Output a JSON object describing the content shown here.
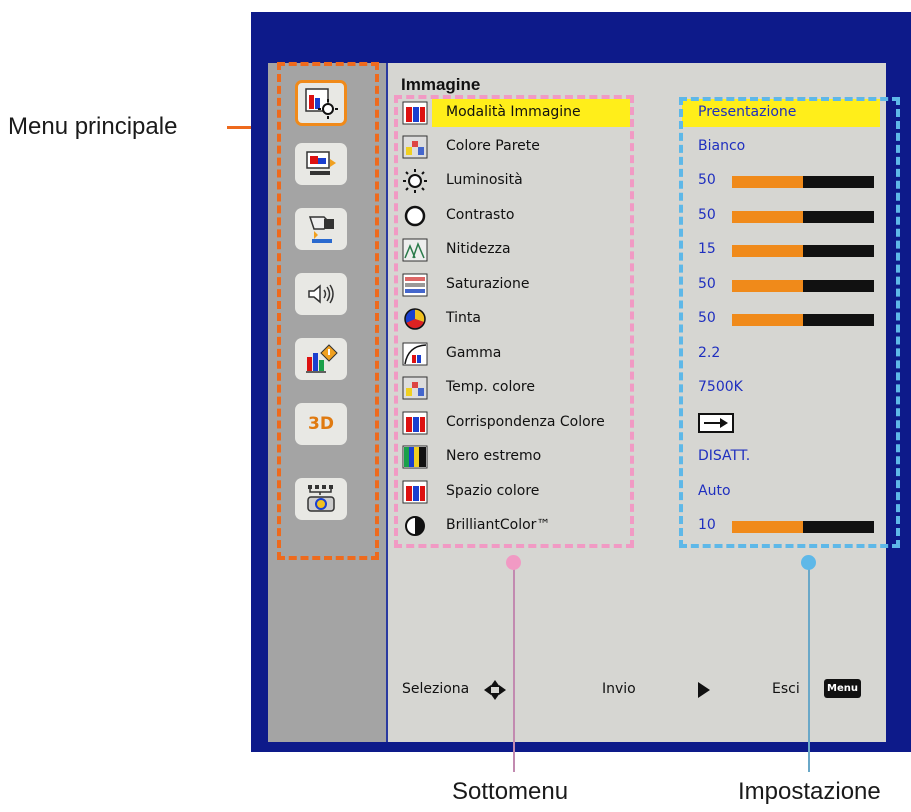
{
  "callouts": {
    "main_menu": "Menu principale",
    "submenu": "Sottomenu",
    "setting": "Impostazione"
  },
  "menu": {
    "title": "Immagine",
    "sidebar_icons": [
      "image-icon",
      "display-icon",
      "setup-icon",
      "audio-icon",
      "options-icon",
      "3d-icon",
      "lan-icon"
    ],
    "sidebar_3d_label": "3D",
    "rows": [
      {
        "label": "Modalità Immagine",
        "value": "Presentazione",
        "icon": "image-mode-icon",
        "selected": true
      },
      {
        "label": "Colore Parete",
        "value": "Bianco",
        "icon": "wall-color-icon"
      },
      {
        "label": "Luminosità",
        "value": "50",
        "icon": "brightness-icon",
        "level": 0.5
      },
      {
        "label": "Contrasto",
        "value": "50",
        "icon": "contrast-icon",
        "level": 0.5
      },
      {
        "label": "Nitidezza",
        "value": "15",
        "icon": "sharpness-icon",
        "level": 0.5
      },
      {
        "label": "Saturazione",
        "value": "50",
        "icon": "saturation-icon",
        "level": 0.5
      },
      {
        "label": "Tinta",
        "value": "50",
        "icon": "tint-icon",
        "level": 0.5
      },
      {
        "label": "Gamma",
        "value": "2.2",
        "icon": "gamma-icon"
      },
      {
        "label": "Temp. colore",
        "value": "7500K",
        "icon": "color-temp-icon"
      },
      {
        "label": "Corrispondenza Colore",
        "value": "",
        "icon": "color-matching-icon",
        "enter": true
      },
      {
        "label": "Nero estremo",
        "value": "DISATT.",
        "icon": "extreme-black-icon"
      },
      {
        "label": "Spazio colore",
        "value": "Auto",
        "icon": "color-space-icon"
      },
      {
        "label": "BrilliantColor™",
        "value": "10",
        "icon": "brilliantcolor-icon",
        "level": 0.5
      }
    ],
    "footer": {
      "select": "Seleziona",
      "enter": "Invio",
      "exit": "Esci",
      "menu_key": "Menu"
    }
  },
  "colors": {
    "frame": "#0d1a8a",
    "highlight": "#ffee1a",
    "value_text": "#1f2fbf",
    "bar_fill": "#f08a1a"
  }
}
